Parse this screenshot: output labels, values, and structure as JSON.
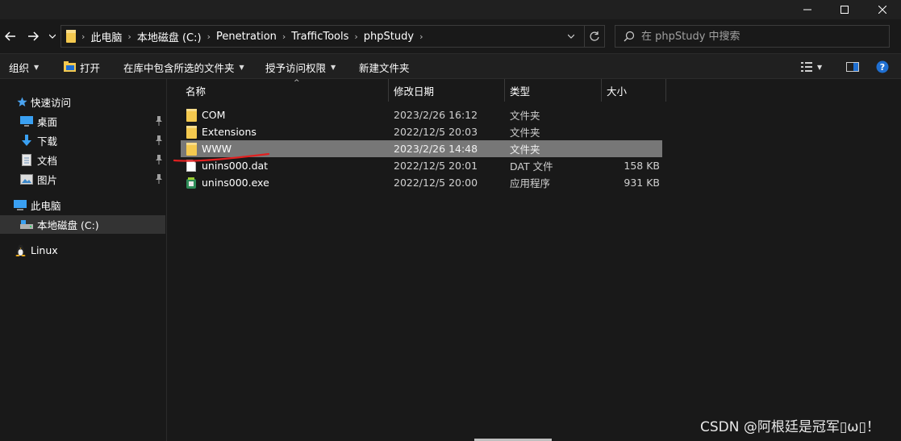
{
  "window": {
    "buttons": [
      "minimize",
      "maximize",
      "close"
    ]
  },
  "nav": {
    "back_icon": "arrow-left-icon",
    "forward_icon": "arrow-right-icon",
    "recent_icon": "chevron-down-icon"
  },
  "address": {
    "crumbs": [
      "此电脑",
      "本地磁盘 (C:)",
      "Penetration",
      "TrafficTools",
      "phpStudy"
    ],
    "dropdown_icon": "chevron-down-icon",
    "refresh_icon": "refresh-icon"
  },
  "search": {
    "placeholder": "在 phpStudy 中搜索"
  },
  "toolbar": {
    "organize": "组织",
    "open": "打开",
    "include_in_library": "在库中包含所选的文件夹",
    "share_access": "授予访问权限",
    "new_folder": "新建文件夹"
  },
  "sidebar": {
    "quick_access": "快速访问",
    "items": [
      {
        "label": "桌面",
        "icon": "desktop-icon",
        "pinned": true
      },
      {
        "label": "下载",
        "icon": "download-icon",
        "pinned": true
      },
      {
        "label": "文档",
        "icon": "document-icon",
        "pinned": true
      },
      {
        "label": "图片",
        "icon": "picture-icon",
        "pinned": true
      }
    ],
    "this_pc": "此电脑",
    "local_disk": "本地磁盘 (C:)",
    "linux": "Linux"
  },
  "columns": {
    "name": "名称",
    "date": "修改日期",
    "type": "类型",
    "size": "大小"
  },
  "files": [
    {
      "name": "COM",
      "date": "2023/2/26 16:12",
      "type": "文件夹",
      "size": "",
      "icon": "folder-icon"
    },
    {
      "name": "Extensions",
      "date": "2022/12/5 20:03",
      "type": "文件夹",
      "size": "",
      "icon": "folder-icon"
    },
    {
      "name": "WWW",
      "date": "2023/2/26 14:48",
      "type": "文件夹",
      "size": "",
      "icon": "folder-icon",
      "selected": true
    },
    {
      "name": "unins000.dat",
      "date": "2022/12/5 20:01",
      "type": "DAT 文件",
      "size": "158 KB",
      "icon": "file-icon"
    },
    {
      "name": "unins000.exe",
      "date": "2022/12/5 20:00",
      "type": "应用程序",
      "size": "931 KB",
      "icon": "app-icon"
    }
  ],
  "watermark": "CSDN @阿根廷是冠军▯ω▯！",
  "colors": {
    "background": "#191919",
    "toolbar": "#202020",
    "selected_row": "#777777",
    "folder": "#f4c94f",
    "annotation_red": "#e02020",
    "help_blue": "#1f6fd1"
  }
}
